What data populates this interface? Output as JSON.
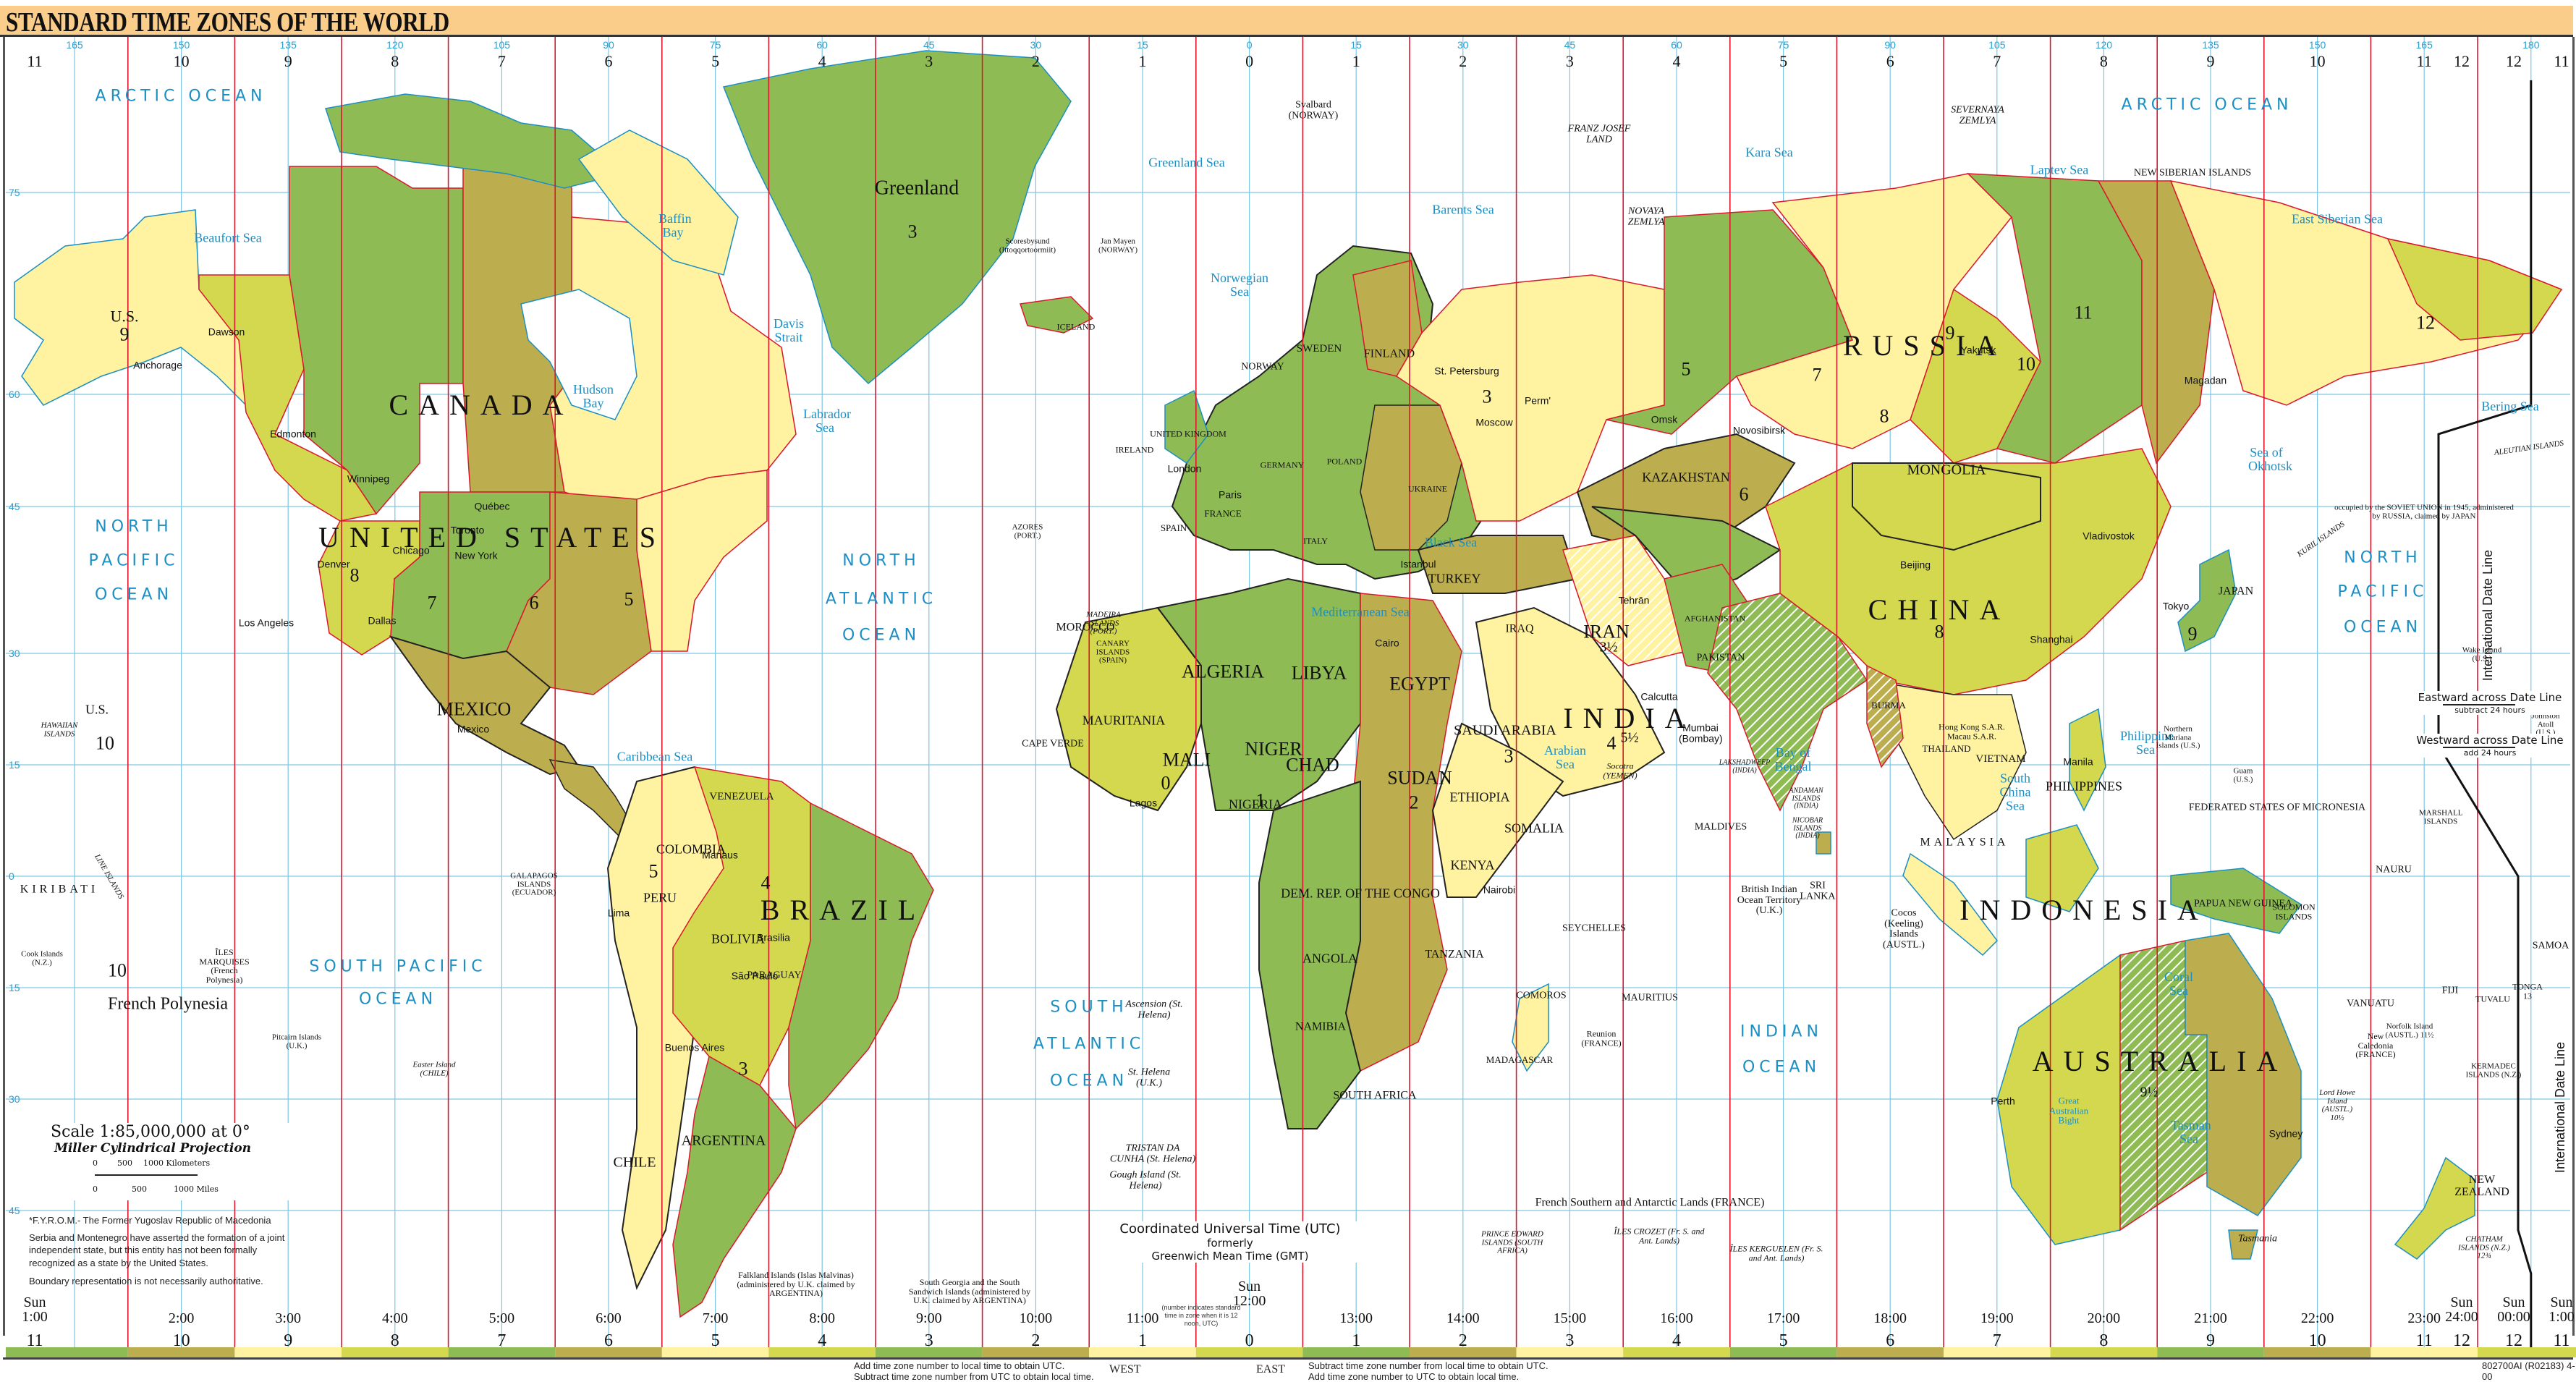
{
  "title": "STANDARD TIME ZONES OF THE WORLD",
  "colors": {
    "title_bar": "#fbcd8a",
    "zone_green": "#8fbb55",
    "zone_olive": "#bcae4e",
    "zone_pale_yellow": "#fff2a0",
    "zone_yellow_green": "#d4d84e",
    "zone_boundary": "#d9182e",
    "graticule": "#7fc6e4",
    "ocean_label": "#1b8fc4",
    "water": "#ffffff"
  },
  "longitude_ticks": [
    "165",
    "150",
    "135",
    "120",
    "105",
    "90",
    "75",
    "60",
    "45",
    "30",
    "15",
    "0",
    "15",
    "30",
    "45",
    "60",
    "75",
    "90",
    "105",
    "120",
    "135",
    "150",
    "165",
    "180"
  ],
  "latitude_ticks": [
    "75",
    "60",
    "45",
    "30",
    "15",
    "0",
    "15",
    "30",
    "45"
  ],
  "top_zone_numbers": [
    "11",
    "10",
    "9",
    "8",
    "7",
    "6",
    "5",
    "4",
    "3",
    "2",
    "1",
    "0",
    "1",
    "2",
    "3",
    "4",
    "5",
    "6",
    "7",
    "8",
    "9",
    "10",
    "11",
    "12",
    "12",
    "11"
  ],
  "bottom_times": [
    {
      "day": "Sun",
      "time": "1:00",
      "zone": "11"
    },
    {
      "day": "",
      "time": "2:00",
      "zone": "10"
    },
    {
      "day": "",
      "time": "3:00",
      "zone": "9"
    },
    {
      "day": "",
      "time": "4:00",
      "zone": "8"
    },
    {
      "day": "",
      "time": "5:00",
      "zone": "7"
    },
    {
      "day": "",
      "time": "6:00",
      "zone": "6"
    },
    {
      "day": "",
      "time": "7:00",
      "zone": "5"
    },
    {
      "day": "",
      "time": "8:00",
      "zone": "4"
    },
    {
      "day": "",
      "time": "9:00",
      "zone": "3"
    },
    {
      "day": "",
      "time": "10:00",
      "zone": "2"
    },
    {
      "day": "",
      "time": "11:00",
      "zone": "1"
    },
    {
      "day": "Sun",
      "time": "12:00",
      "zone": "0"
    },
    {
      "day": "",
      "time": "13:00",
      "zone": "1"
    },
    {
      "day": "",
      "time": "14:00",
      "zone": "2"
    },
    {
      "day": "",
      "time": "15:00",
      "zone": "3"
    },
    {
      "day": "",
      "time": "16:00",
      "zone": "4"
    },
    {
      "day": "",
      "time": "17:00",
      "zone": "5"
    },
    {
      "day": "",
      "time": "18:00",
      "zone": "6"
    },
    {
      "day": "",
      "time": "19:00",
      "zone": "7"
    },
    {
      "day": "",
      "time": "20:00",
      "zone": "8"
    },
    {
      "day": "",
      "time": "21:00",
      "zone": "9"
    },
    {
      "day": "",
      "time": "22:00",
      "zone": "10"
    },
    {
      "day": "",
      "time": "23:00",
      "zone": "11"
    },
    {
      "day": "Sun",
      "time": "24:00",
      "zone": "12"
    },
    {
      "day": "Sun",
      "time": "00:00",
      "zone": "12"
    },
    {
      "day": "Sun",
      "time": "1:00",
      "zone": "11"
    }
  ],
  "utc_note": "(number indicates standard time in zone when it is 12 noon, UTC)",
  "utc_title": {
    "line1": "Coordinated Universal Time (UTC)",
    "line2": "formerly",
    "line3": "Greenwich Mean Time (GMT)"
  },
  "legend": {
    "scale": "Scale 1:85,000,000 at 0°",
    "projection": "Miller Cylindrical Projection",
    "km_ticks": [
      "0",
      "500",
      "1000 Kilometers"
    ],
    "mile_ticks": [
      "0",
      "500",
      "1000 Miles"
    ]
  },
  "notes": [
    "*F.Y.R.O.M.- The Former Yugoslav Republic of Macedonia",
    "Serbia and Montenegro have asserted the formation of a joint independent state, but this entity has not been formally recognized as a state by the United States.",
    "Boundary representation is not necessarily authoritative."
  ],
  "footer": {
    "west_label": "WEST",
    "east_label": "EAST",
    "west_line1": "Add time zone number to local time to obtain UTC.",
    "west_line2": "Subtract time zone number from UTC to obtain local time.",
    "east_line1": "Subtract time zone number from local time to obtain UTC.",
    "east_line2": "Add time zone number to UTC to obtain local time.",
    "code": "802700AI (R02183) 4-00"
  },
  "dateline": {
    "label": "International Date Line",
    "eastward": "Eastward across Date Line",
    "eastward_sub": "subtract 24 hours",
    "westward": "Westward across Date Line",
    "westward_sub": "add 24 hours"
  },
  "oceans": [
    {
      "id": "arctic-w",
      "text": "ARCTIC OCEAN"
    },
    {
      "id": "arctic-e",
      "text": "ARCTIC OCEAN"
    },
    {
      "id": "npac-w1",
      "text": "NORTH"
    },
    {
      "id": "npac-w2",
      "text": "PACIFIC"
    },
    {
      "id": "npac-w3",
      "text": "OCEAN"
    },
    {
      "id": "natl1",
      "text": "NORTH"
    },
    {
      "id": "natl2",
      "text": "ATLANTIC"
    },
    {
      "id": "natl3",
      "text": "OCEAN"
    },
    {
      "id": "spac1",
      "text": "SOUTH PACIFIC"
    },
    {
      "id": "spac2",
      "text": "OCEAN"
    },
    {
      "id": "satl1",
      "text": "SOUTH"
    },
    {
      "id": "satl2",
      "text": "ATLANTIC"
    },
    {
      "id": "satl3",
      "text": "OCEAN"
    },
    {
      "id": "ind1",
      "text": "INDIAN"
    },
    {
      "id": "ind2",
      "text": "OCEAN"
    },
    {
      "id": "npac-e1",
      "text": "NORTH"
    },
    {
      "id": "npac-e2",
      "text": "PACIFIC"
    },
    {
      "id": "npac-e3",
      "text": "OCEAN"
    }
  ],
  "countries_big": [
    {
      "id": "canada",
      "text": "CANADA"
    },
    {
      "id": "us",
      "text": "UNITED STATES"
    },
    {
      "id": "russia",
      "text": "RUSSIA"
    },
    {
      "id": "china",
      "text": "CHINA"
    },
    {
      "id": "brazil",
      "text": "BRAZIL"
    },
    {
      "id": "australia",
      "text": "AUSTRALIA"
    },
    {
      "id": "india",
      "text": "INDIA"
    },
    {
      "id": "indonesia",
      "text": "INDONESIA"
    },
    {
      "id": "greenland",
      "text": "Greenland"
    }
  ],
  "countries": [
    {
      "id": "mexico",
      "text": "MEXICO"
    },
    {
      "id": "algeria",
      "text": "ALGERIA"
    },
    {
      "id": "libya",
      "text": "LIBYA"
    },
    {
      "id": "egypt",
      "text": "EGYPT"
    },
    {
      "id": "sudan",
      "text": "SUDAN"
    },
    {
      "id": "niger",
      "text": "NIGER"
    },
    {
      "id": "chad",
      "text": "CHAD"
    },
    {
      "id": "mali",
      "text": "MALI"
    },
    {
      "id": "mauritania",
      "text": "MAURITANIA"
    },
    {
      "id": "nigeria",
      "text": "NIGERIA"
    },
    {
      "id": "ethiopia",
      "text": "ETHIOPIA"
    },
    {
      "id": "somalia",
      "text": "SOMALIA"
    },
    {
      "id": "kenya",
      "text": "KENYA"
    },
    {
      "id": "angola",
      "text": "ANGOLA"
    },
    {
      "id": "namibia",
      "text": "NAMIBIA"
    },
    {
      "id": "southafrica",
      "text": "SOUTH AFRICA"
    },
    {
      "id": "drc",
      "text": "DEM. REP. OF THE CONGO"
    },
    {
      "id": "tanzania",
      "text": "TANZANIA"
    },
    {
      "id": "saudi",
      "text": "SAUDI ARABIA"
    },
    {
      "id": "iran",
      "text": "IRAN"
    },
    {
      "id": "iraq",
      "text": "IRAQ"
    },
    {
      "id": "turkey",
      "text": "TURKEY"
    },
    {
      "id": "kazakhstan",
      "text": "KAZAKHSTAN"
    },
    {
      "id": "mongolia",
      "text": "MONGOLIA"
    },
    {
      "id": "pakistan",
      "text": "PAKISTAN"
    },
    {
      "id": "afghanistan",
      "text": "AFGHANISTAN"
    },
    {
      "id": "burma",
      "text": "BURMA"
    },
    {
      "id": "thailand",
      "text": "THAILAND"
    },
    {
      "id": "vietnam",
      "text": "VIETNAM"
    },
    {
      "id": "philippines",
      "text": "PHILIPPINES"
    },
    {
      "id": "malaysia",
      "text": "MALAYSIA"
    },
    {
      "id": "japan",
      "text": "JAPAN"
    },
    {
      "id": "png",
      "text": "PAPUA NEW GUINEA"
    },
    {
      "id": "nz",
      "text": "NEW ZEALAND"
    },
    {
      "id": "finland",
      "text": "FINLAND"
    },
    {
      "id": "sweden",
      "text": "SWEDEN"
    },
    {
      "id": "norway",
      "text": "NORWAY"
    },
    {
      "id": "france",
      "text": "FRANCE"
    },
    {
      "id": "spain",
      "text": "SPAIN"
    },
    {
      "id": "germany",
      "text": "GERMANY"
    },
    {
      "id": "poland",
      "text": "POLAND"
    },
    {
      "id": "ukraine",
      "text": "UKRAINE"
    },
    {
      "id": "italy",
      "text": "ITALY"
    },
    {
      "id": "uk",
      "text": "UNITED KINGDOM"
    },
    {
      "id": "ireland",
      "text": "IRELAND"
    },
    {
      "id": "iceland",
      "text": "ICELAND"
    },
    {
      "id": "colombia",
      "text": "COLOMBIA"
    },
    {
      "id": "venezuela",
      "text": "VENEZUELA"
    },
    {
      "id": "peru",
      "text": "PERU"
    },
    {
      "id": "bolivia",
      "text": "BOLIVIA"
    },
    {
      "id": "argentina",
      "text": "ARGENTINA"
    },
    {
      "id": "chile",
      "text": "CHILE"
    },
    {
      "id": "paraguay",
      "text": "PARAGUAY"
    },
    {
      "id": "morocco",
      "text": "MOROCCO"
    },
    {
      "id": "madagascar",
      "text": "MADAGASCAR"
    },
    {
      "id": "srilanka",
      "text": "SRI LANKA"
    },
    {
      "id": "kiribati",
      "text": "KIRIBATI"
    },
    {
      "id": "us-alaska",
      "text": "U.S."
    },
    {
      "id": "us-hawaii",
      "text": "U.S."
    },
    {
      "id": "french-polynesia",
      "text": "French Polynesia"
    }
  ],
  "zone_labels": [
    {
      "id": "z-alaska",
      "text": "9"
    },
    {
      "id": "z-us8",
      "text": "8"
    },
    {
      "id": "z-us7",
      "text": "7"
    },
    {
      "id": "z-us6",
      "text": "6"
    },
    {
      "id": "z-us5",
      "text": "5"
    },
    {
      "id": "z-greenland",
      "text": "3"
    },
    {
      "id": "z-hawaii",
      "text": "10"
    },
    {
      "id": "z-brazil4",
      "text": "4"
    },
    {
      "id": "z-arg3",
      "text": "3"
    },
    {
      "id": "z-peru5",
      "text": "5"
    },
    {
      "id": "z-mali0",
      "text": "0"
    },
    {
      "id": "z-chad1",
      "text": "1"
    },
    {
      "id": "z-sudan2",
      "text": "2"
    },
    {
      "id": "z-saudi3",
      "text": "3"
    },
    {
      "id": "z-iran",
      "text": "3½"
    },
    {
      "id": "z-india",
      "text": "5½"
    },
    {
      "id": "z-russia3",
      "text": "3"
    },
    {
      "id": "z-russia5",
      "text": "5"
    },
    {
      "id": "z-russia7",
      "text": "7"
    },
    {
      "id": "z-russia8",
      "text": "8"
    },
    {
      "id": "z-russia9",
      "text": "9"
    },
    {
      "id": "z-russia10",
      "text": "10"
    },
    {
      "id": "z-russia11",
      "text": "11"
    },
    {
      "id": "z-russia12",
      "text": "12"
    },
    {
      "id": "z-china8",
      "text": "8"
    },
    {
      "id": "z-japan9",
      "text": "9"
    },
    {
      "id": "z-aus",
      "text": "9½"
    },
    {
      "id": "z-kaz6",
      "text": "6"
    },
    {
      "id": "z-fpoly",
      "text": "10"
    },
    {
      "id": "z-arabian4",
      "text": "4"
    }
  ],
  "seas": [
    {
      "id": "hudson",
      "text": "Hudson Bay"
    },
    {
      "id": "beaufort",
      "text": "Beaufort Sea"
    },
    {
      "id": "labrador",
      "text": "Labrador Sea"
    },
    {
      "id": "greenland-sea",
      "text": "Greenland Sea"
    },
    {
      "id": "barents",
      "text": "Barents Sea"
    },
    {
      "id": "kara",
      "text": "Kara Sea"
    },
    {
      "id": "laptev",
      "text": "Laptev Sea"
    },
    {
      "id": "esib",
      "text": "East Siberian Sea"
    },
    {
      "id": "bering",
      "text": "Bering Sea"
    },
    {
      "id": "okhotsk",
      "text": "Sea of Okhotsk"
    },
    {
      "id": "med",
      "text": "Mediterranean Sea"
    },
    {
      "id": "arabian",
      "text": "Arabian Sea"
    },
    {
      "id": "bengal",
      "text": "Bay of Bengal"
    },
    {
      "id": "scs",
      "text": "South China Sea"
    },
    {
      "id": "coral",
      "text": "Coral Sea"
    },
    {
      "id": "tasman",
      "text": "Tasman Sea"
    },
    {
      "id": "caribbean",
      "text": "Caribbean Sea"
    },
    {
      "id": "norwegian",
      "text": "Norwegian Sea"
    },
    {
      "id": "philippine",
      "text": "Philippine Sea"
    },
    {
      "id": "gab",
      "text": "Great Australian Bight"
    },
    {
      "id": "davis",
      "text": "Davis Strait"
    },
    {
      "id": "baffin",
      "text": "Baffin Bay"
    },
    {
      "id": "black",
      "text": "Black Sea"
    }
  ],
  "cities": [
    {
      "id": "anchorage",
      "text": "Anchorage"
    },
    {
      "id": "dawson",
      "text": "Dawson"
    },
    {
      "id": "edmonton",
      "text": "Edmonton"
    },
    {
      "id": "winnipeg",
      "text": "Winnipeg"
    },
    {
      "id": "denver",
      "text": "Denver"
    },
    {
      "id": "la",
      "text": "Los Angeles"
    },
    {
      "id": "dallas",
      "text": "Dallas"
    },
    {
      "id": "chicago",
      "text": "Chicago"
    },
    {
      "id": "ny",
      "text": "New York"
    },
    {
      "id": "toronto",
      "text": "Toronto"
    },
    {
      "id": "quebec",
      "text": "Québec"
    },
    {
      "id": "mexicocity",
      "text": "Mexico"
    },
    {
      "id": "lima",
      "text": "Lima"
    },
    {
      "id": "manaus",
      "text": "Manaus"
    },
    {
      "id": "brasilia",
      "text": "Brasilia"
    },
    {
      "id": "saopaulo",
      "text": "São Paulo"
    },
    {
      "id": "ba",
      "text": "Buenos Aires"
    },
    {
      "id": "london",
      "text": "London"
    },
    {
      "id": "paris",
      "text": "Paris"
    },
    {
      "id": "moscow",
      "text": "Moscow"
    },
    {
      "id": "stp",
      "text": "St. Petersburg"
    },
    {
      "id": "cairo",
      "text": "Cairo"
    },
    {
      "id": "lagos",
      "text": "Lagos"
    },
    {
      "id": "nairobi",
      "text": "Nairobi"
    },
    {
      "id": "tehran",
      "text": "Tehrān"
    },
    {
      "id": "mumbai",
      "text": "Mumbai (Bombay)"
    },
    {
      "id": "calcutta",
      "text": "Calcutta"
    },
    {
      "id": "beijing",
      "text": "Beijing"
    },
    {
      "id": "shanghai",
      "text": "Shanghai"
    },
    {
      "id": "tokyo",
      "text": "Tokyo"
    },
    {
      "id": "yakutsk",
      "text": "Yakutsk"
    },
    {
      "id": "magadan",
      "text": "Magadan"
    },
    {
      "id": "vladivostok",
      "text": "Vladivostok"
    },
    {
      "id": "novosibirsk",
      "text": "Novosibirsk"
    },
    {
      "id": "perth",
      "text": "Perth"
    },
    {
      "id": "sydney",
      "text": "Sydney"
    },
    {
      "id": "manila",
      "text": "Manila"
    },
    {
      "id": "istanbul",
      "text": "Istanbul"
    },
    {
      "id": "omsk",
      "text": "Omsk"
    },
    {
      "id": "perm",
      "text": "Perm'"
    }
  ],
  "islands": [
    {
      "id": "svalbard",
      "text": "Svalbard (NORWAY)"
    },
    {
      "id": "fjl",
      "text": "FRANZ JOSEF LAND"
    },
    {
      "id": "nz-arc",
      "text": "NOVAYA ZEMLYA"
    },
    {
      "id": "severnaya",
      "text": "SEVERNAYA ZEMLYA"
    },
    {
      "id": "nsi",
      "text": "NEW SIBERIAN ISLANDS"
    },
    {
      "id": "azores",
      "text": "AZORES (PORT.)"
    },
    {
      "id": "capeverde",
      "text": "CAPE VERDE"
    },
    {
      "id": "madeira",
      "text": "MADEIRA ISLANDS (PORT.)"
    },
    {
      "id": "canary",
      "text": "CANARY ISLANDS (SPAIN)"
    },
    {
      "id": "sthelena",
      "text": "St. Helena (U.K.)"
    },
    {
      "id": "tristan",
      "text": "TRISTAN DA CUNHA (St. Helena)"
    },
    {
      "id": "gough",
      "text": "Gough Island (St. Helena)"
    },
    {
      "id": "ascension",
      "text": "Ascension (St. Helena)"
    },
    {
      "id": "falklands",
      "text": "Falkland Islands (Islas Malvinas) (administered by U.K. claimed by ARGENTINA)"
    },
    {
      "id": "ssgi",
      "text": "South Georgia and the South Sandwich Islands (administered by U.K. claimed by ARGENTINA)"
    },
    {
      "id": "crozet",
      "text": "ÎLES CROZET (Fr. S. and Ant. Lands)"
    },
    {
      "id": "kerguelen",
      "text": "ÎLES KERGUELEN (Fr. S. and Ant. Lands)"
    },
    {
      "id": "fsal",
      "text": "French Southern and Antarctic Lands (FRANCE)"
    },
    {
      "id": "pei",
      "text": "PRINCE EDWARD ISLANDS (SOUTH AFRICA)"
    },
    {
      "id": "maldives",
      "text": "MALDIVES"
    },
    {
      "id": "biot",
      "text": "British Indian Ocean Territory (U.K.)"
    },
    {
      "id": "cocos",
      "text": "Cocos (Keeling) Islands (AUSTL.)"
    },
    {
      "id": "seychelles",
      "text": "SEYCHELLES"
    },
    {
      "id": "mauritius",
      "text": "MAURITIUS"
    },
    {
      "id": "reunion",
      "text": "Reunion (FRANCE)"
    },
    {
      "id": "marquesas",
      "text": "ÎLES MARQUISES (French Polynesia)"
    },
    {
      "id": "pitcairn",
      "text": "Pitcairn Islands (U.K.)"
    },
    {
      "id": "easter",
      "text": "Easter Island (CHILE)"
    },
    {
      "id": "galapagos",
      "text": "GALAPAGOS ISLANDS (ECUADOR)"
    },
    {
      "id": "cook",
      "text": "Cook Islands (N.Z.)"
    },
    {
      "id": "hawaiian",
      "text": "HAWAIIAN ISLANDS"
    },
    {
      "id": "line",
      "text": "LINE ISLANDS"
    },
    {
      "id": "solomon",
      "text": "SOLOMON ISLANDS"
    },
    {
      "id": "vanuatu",
      "text": "VANUATU"
    },
    {
      "id": "newcal",
      "text": "New Caledonia (FRANCE)"
    },
    {
      "id": "fiji",
      "text": "FIJI"
    },
    {
      "id": "tonga",
      "text": "TONGA 13"
    },
    {
      "id": "samoa",
      "text": "SAMOA"
    },
    {
      "id": "tuvalu",
      "text": "TUVALU"
    },
    {
      "id": "nauru",
      "text": "NAURU"
    },
    {
      "id": "kermadec",
      "text": "KERMADEC ISLANDS (N.Z.)"
    },
    {
      "id": "chatham",
      "text": "CHATHAM ISLANDS (N.Z.) 12¾"
    },
    {
      "id": "norfolk",
      "text": "Norfolk Island (AUSTL.) 11½"
    },
    {
      "id": "lordhowe",
      "text": "Lord Howe Island (AUSTL.) 10½"
    },
    {
      "id": "johnston",
      "text": "Johnston Atoll (U.S.)"
    },
    {
      "id": "wake",
      "text": "Wake Island (U.S.)"
    },
    {
      "id": "marshall",
      "text": "MARSHALL ISLANDS"
    },
    {
      "id": "fsm",
      "text": "FEDERATED STATES OF MICRONESIA"
    },
    {
      "id": "nmariana",
      "text": "Northern Mariana Islands (U.S.)"
    },
    {
      "id": "guam",
      "text": "Guam (U.S.)"
    },
    {
      "id": "aleutian",
      "text": "ALEUTIAN ISLANDS"
    },
    {
      "id": "kuril",
      "text": "KURIL ISLANDS"
    },
    {
      "id": "tasmania",
      "text": "Tasmania"
    },
    {
      "id": "hk",
      "text": "Hong Kong S.A.R. Macau S.A.R."
    },
    {
      "id": "andaman",
      "text": "ANDAMAN ISLANDS (INDIA)"
    },
    {
      "id": "nicobar",
      "text": "NICOBAR ISLANDS (INDIA)"
    },
    {
      "id": "lakshadweep",
      "text": "LAKSHADWEEP (INDIA)"
    },
    {
      "id": "socotra",
      "text": "Socotra (YEMEN)"
    },
    {
      "id": "comoros",
      "text": "COMOROS"
    },
    {
      "id": "janmayen",
      "text": "Jan Mayen (NORWAY)"
    },
    {
      "id": "scoresbysund",
      "text": "Scoresbysund (Ittoqqortoormiit)"
    },
    {
      "id": "kuril-note",
      "text": "occupied by the SOVIET UNION in 1945, administered by RUSSIA, claimed by JAPAN"
    }
  ]
}
